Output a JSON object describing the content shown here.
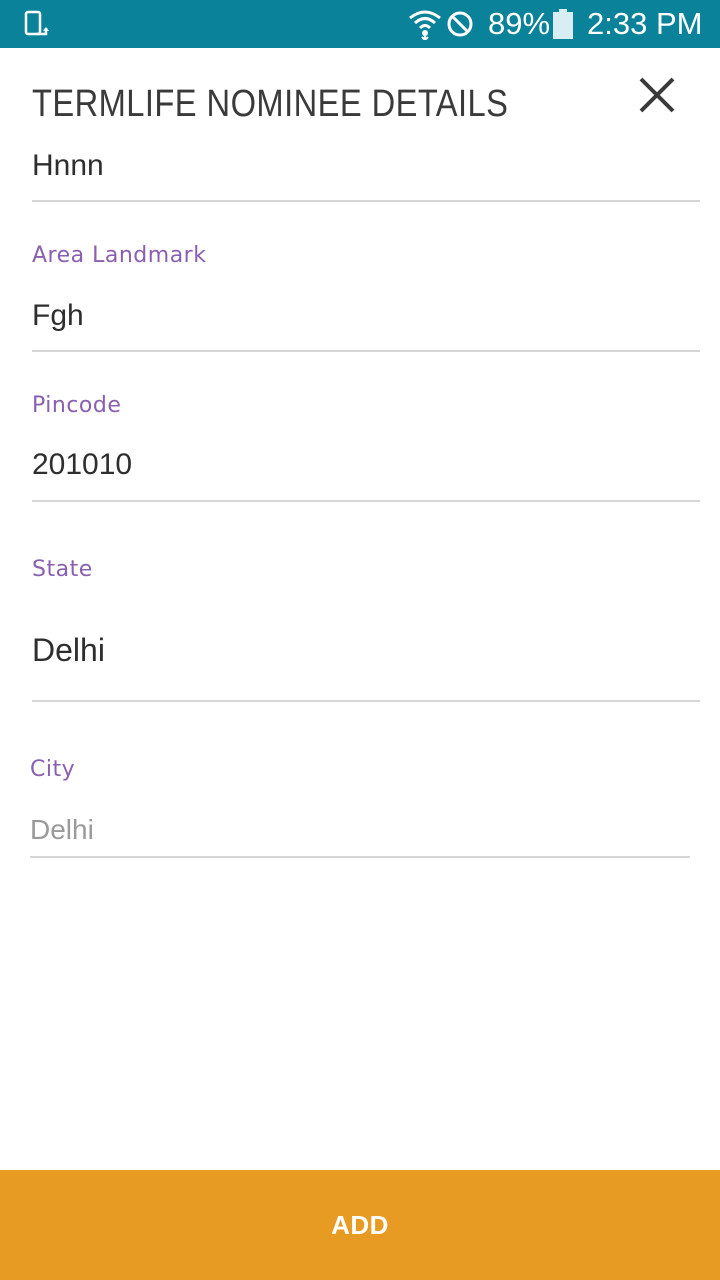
{
  "status_bar": {
    "battery_percent": "89%",
    "time": "2:33 PM",
    "icons": [
      "screen-rotate-icon",
      "wifi-icon",
      "do-not-disturb-icon",
      "battery-icon"
    ],
    "background_color": "#0a8299"
  },
  "dialog": {
    "title": "TERMLIFE NOMINEE DETAILS",
    "close_icon": "close-icon"
  },
  "form": {
    "partial_field": {
      "value": "Hnnn"
    },
    "area_landmark": {
      "label": "Area Landmark",
      "value": "Fgh"
    },
    "pincode": {
      "label": "Pincode",
      "value": "201010"
    },
    "state": {
      "label": "State",
      "value": "Delhi"
    },
    "city": {
      "label": "City",
      "value": "Delhi"
    }
  },
  "footer": {
    "add_label": "ADD",
    "button_color": "#e89b23"
  },
  "colors": {
    "label": "#8a5fb0",
    "text": "#2e2e2e",
    "disabled_text": "#9a9a9a",
    "divider": "#d6d6d6"
  }
}
